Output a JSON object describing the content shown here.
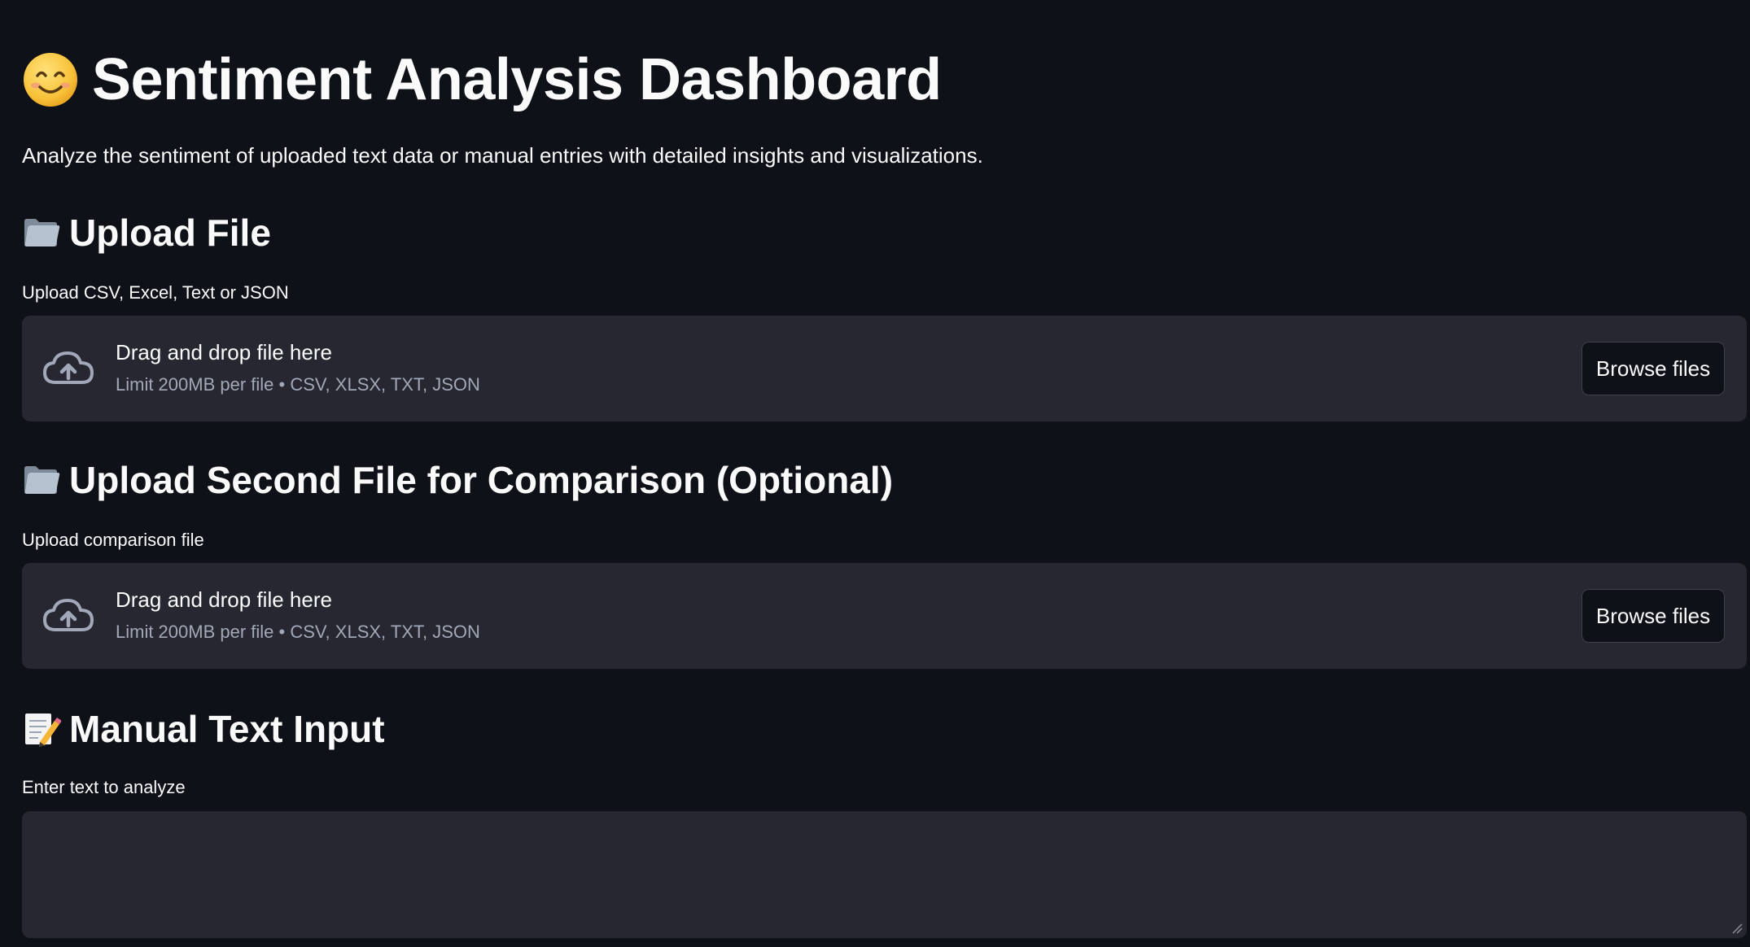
{
  "header": {
    "title": "Sentiment Analysis Dashboard",
    "title_icon": "smiling-face-emoji",
    "subtitle": "Analyze the sentiment of uploaded text data or manual entries with detailed insights and visualizations."
  },
  "upload_primary": {
    "heading": "Upload File",
    "heading_icon": "folder-icon",
    "label": "Upload CSV, Excel, Text or JSON",
    "dropzone_text": "Drag and drop file here",
    "limit_text": "Limit 200MB per file • CSV, XLSX, TXT, JSON",
    "button_label": "Browse files"
  },
  "upload_comparison": {
    "heading": "Upload Second File for Comparison (Optional)",
    "heading_icon": "folder-icon",
    "label": "Upload comparison file",
    "dropzone_text": "Drag and drop file here",
    "limit_text": "Limit 200MB per file • CSV, XLSX, TXT, JSON",
    "button_label": "Browse files"
  },
  "manual_input": {
    "heading": "Manual Text Input",
    "heading_icon": "memo-icon",
    "label": "Enter text to analyze",
    "value": "",
    "placeholder": ""
  },
  "colors": {
    "background": "#0e1117",
    "panel": "#262730",
    "text": "#fafafa",
    "muted_text": "#a3a8b8"
  }
}
